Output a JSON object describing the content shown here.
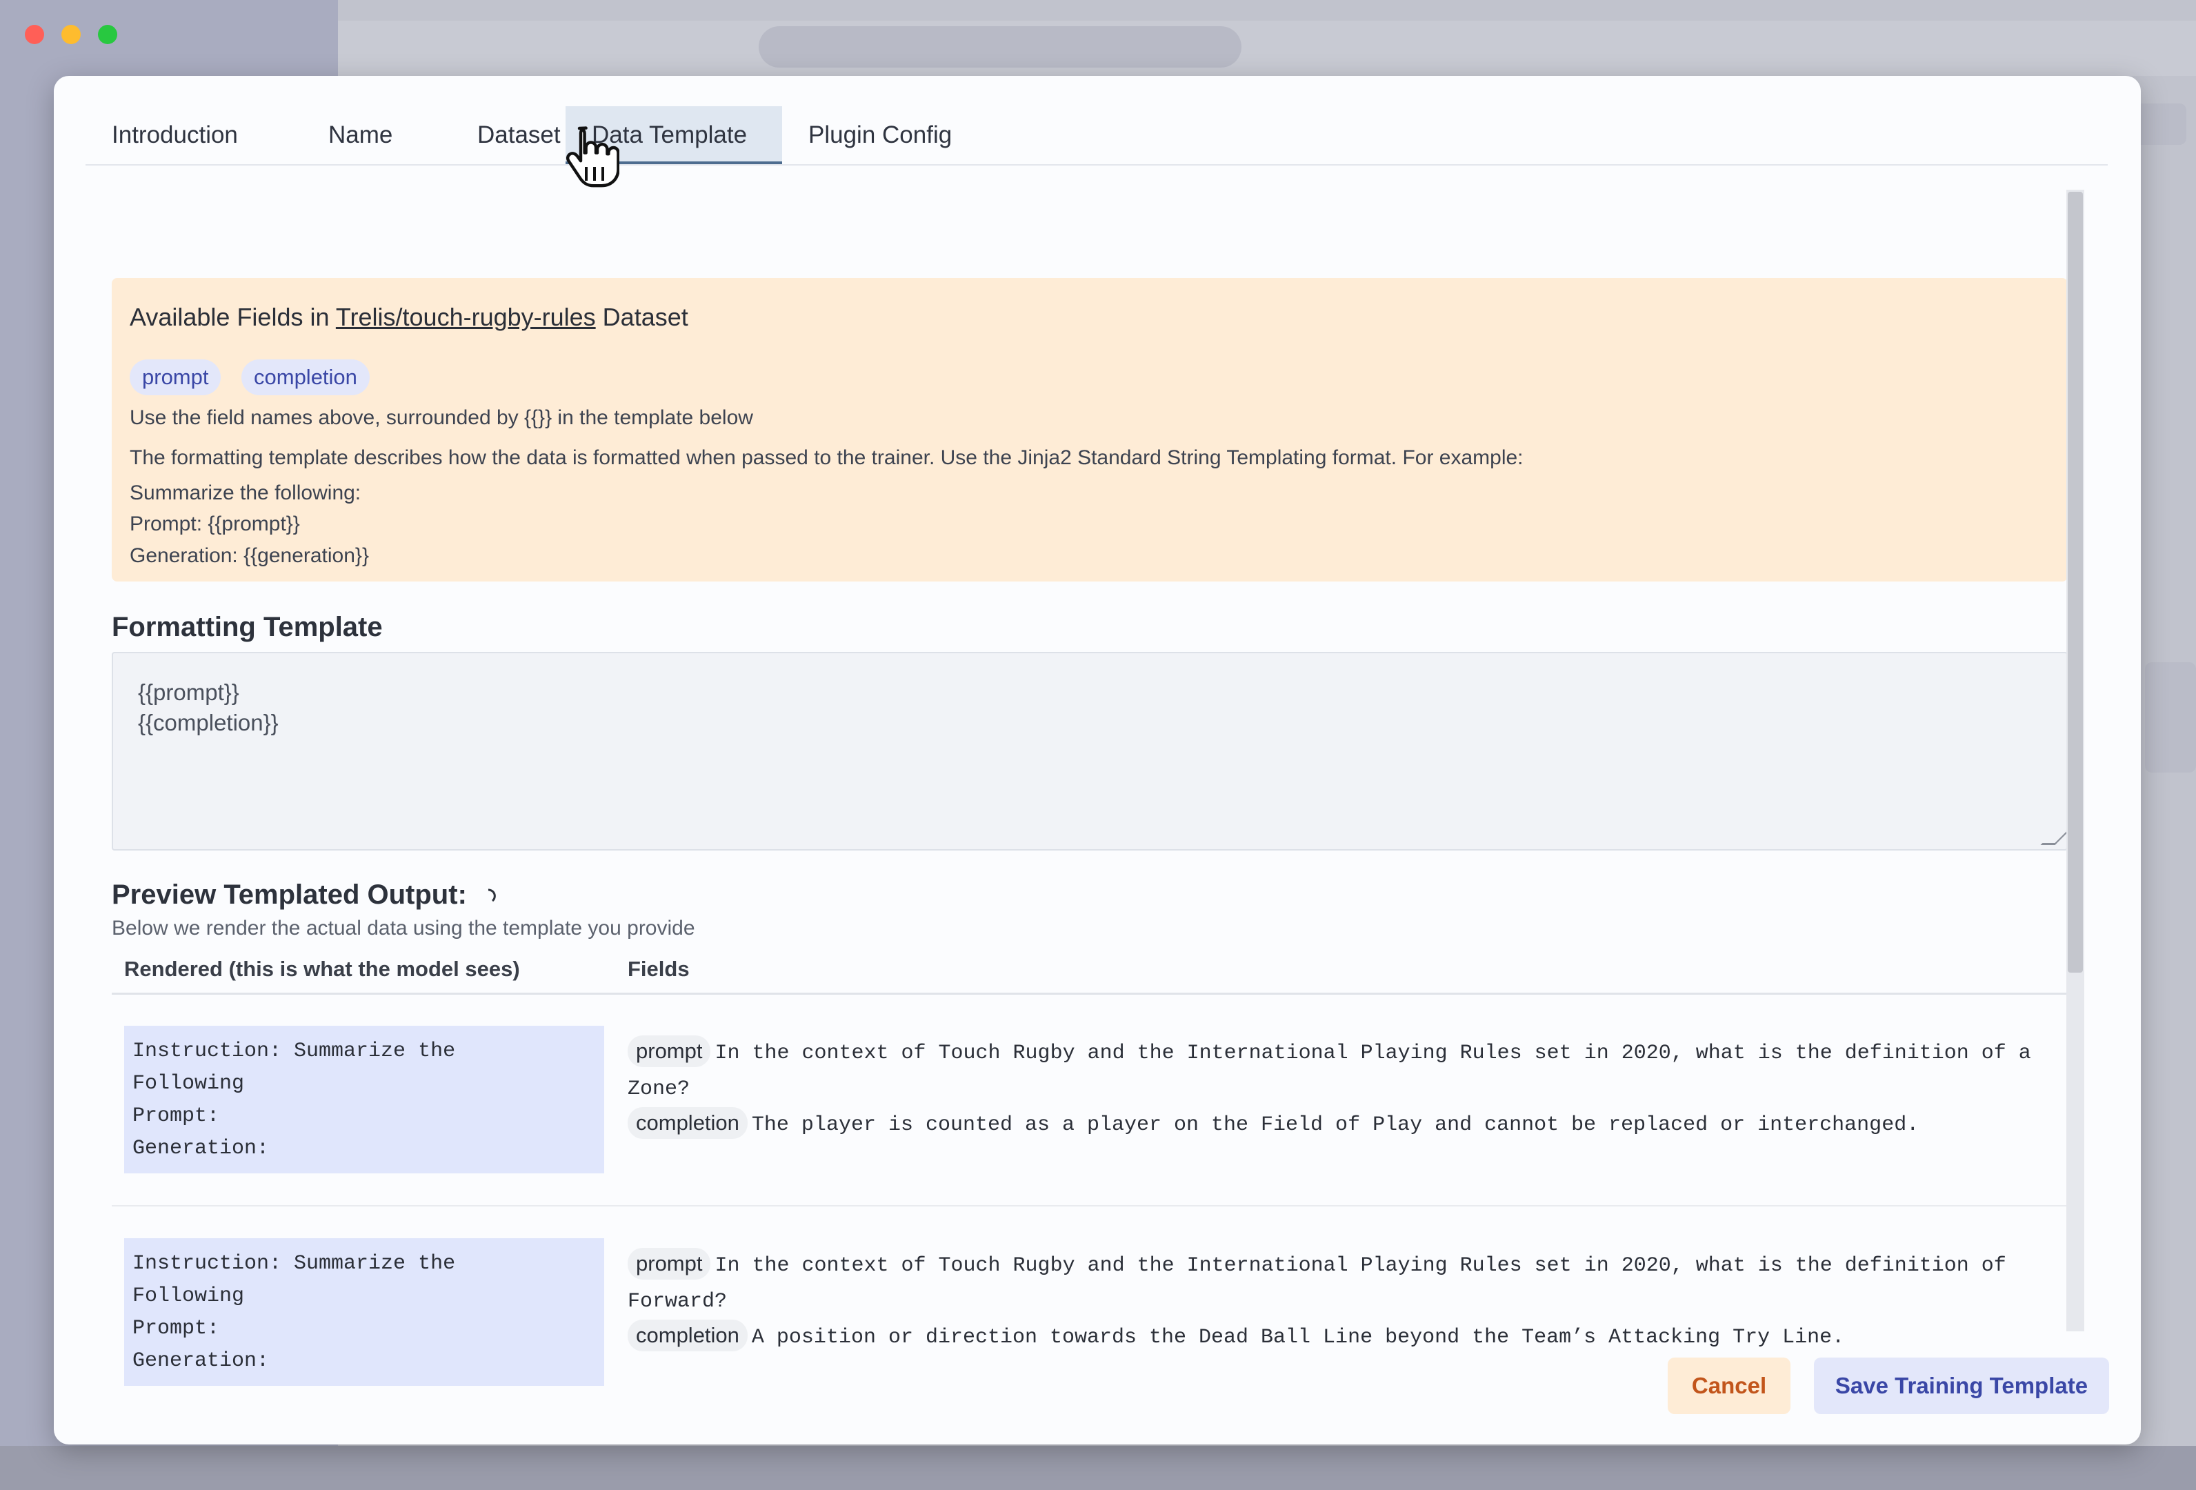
{
  "window": {
    "controls": [
      "close",
      "minimize",
      "maximize"
    ]
  },
  "tabs": [
    {
      "label": "Introduction",
      "active": false
    },
    {
      "label": "Name",
      "active": false
    },
    {
      "label": "Dataset",
      "active": false
    },
    {
      "label": "Data Template",
      "active": true
    },
    {
      "label": "Plugin Config",
      "active": false
    }
  ],
  "info": {
    "title_prefix": "Available Fields in",
    "dataset_link": "Trelis/touch-rugby-rules",
    "title_suffix": "Dataset",
    "fields": [
      "prompt",
      "completion"
    ],
    "hint": "Use the field names above, surrounded by {{}} in the template below",
    "description": "The formatting template describes how the data is formatted when passed to the trainer. Use the Jinja2 Standard String Templating format. For example:",
    "example_lines": [
      "Summarize the following:",
      "Prompt: {{prompt}}",
      "Generation: {{generation}}"
    ]
  },
  "formatting": {
    "title": "Formatting Template",
    "lines": [
      "{{prompt}}",
      "{{completion}}"
    ]
  },
  "preview": {
    "title": "Preview Templated Output:",
    "subtitle": "Below we render the actual data using the template you provide",
    "col_rendered": "Rendered (this is what the model sees)",
    "col_fields": "Fields",
    "rows": [
      {
        "rendered": [
          "Instruction: Summarize the",
          "Following",
          "Prompt:",
          "Generation:"
        ],
        "prompt_label": "prompt",
        "prompt": "In the context of Touch Rugby and the International Playing Rules set in 2020, what is the definition of a Zone?",
        "completion_label": "completion",
        "completion": "The player is counted as a player on the Field of Play and cannot be replaced or interchanged."
      },
      {
        "rendered": [
          "Instruction: Summarize the",
          "Following",
          "Prompt:",
          "Generation:"
        ],
        "prompt_label": "prompt",
        "prompt": "In the context of Touch Rugby and the International Playing Rules set in 2020, what is the definition of Forward?",
        "completion_label": "completion",
        "completion": "A position or direction towards the Dead Ball Line beyond the Team’s Attacking Try Line."
      }
    ]
  },
  "actions": {
    "cancel": "Cancel",
    "save": "Save Training Template"
  },
  "colors": {
    "accent": "#3a47a6",
    "warning_bg": "#feecd6",
    "cancel_text": "#c2551b"
  }
}
